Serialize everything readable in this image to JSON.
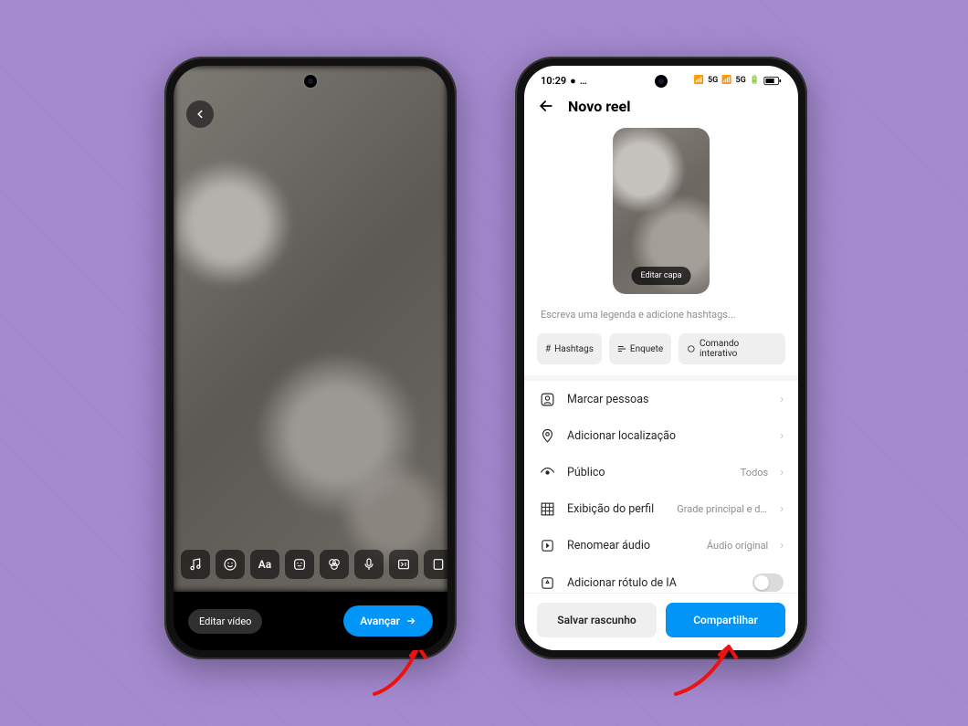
{
  "left_phone": {
    "back_icon": "chevron-left",
    "tools": [
      {
        "name": "music-icon"
      },
      {
        "name": "emoji-icon"
      },
      {
        "name": "text-icon"
      },
      {
        "name": "sticker-icon"
      },
      {
        "name": "effects-icon"
      },
      {
        "name": "voiceover-icon"
      },
      {
        "name": "clip-icon"
      },
      {
        "name": "download-icon"
      }
    ],
    "edit_video_label": "Editar vídeo",
    "advance_label": "Avançar"
  },
  "right_phone": {
    "status": {
      "time": "10:29",
      "net1": "5G",
      "net2": "5G",
      "battery": "66"
    },
    "header_title": "Novo reel",
    "edit_cover_label": "Editar capa",
    "caption_placeholder": "Escreva uma legenda e adicione hashtags...",
    "chips": {
      "hashtags": "Hashtags",
      "enquete": "Enquete",
      "comando": "Comando interativo"
    },
    "options": {
      "tag_people": "Marcar pessoas",
      "add_location": "Adicionar localização",
      "public": "Público",
      "public_value": "Todos",
      "profile_display": "Exibição do perfil",
      "profile_display_value": "Grade principal e do Re...",
      "rename_audio": "Renomear áudio",
      "rename_audio_value": "Áudio original",
      "ai_label": "Adicionar rótulo de IA"
    },
    "footer": {
      "draft": "Salvar rascunho",
      "share": "Compartilhar"
    }
  },
  "colors": {
    "accent": "#0195f7",
    "background": "#a58ad0"
  }
}
